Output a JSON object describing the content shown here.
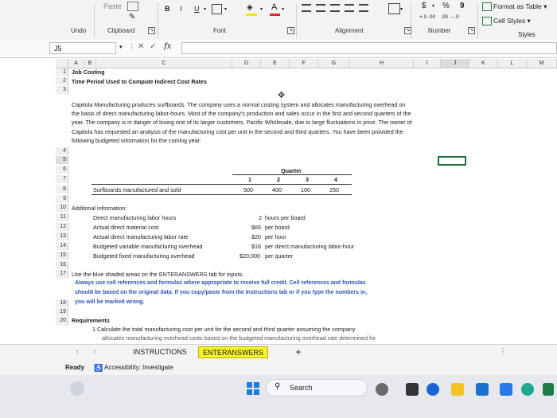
{
  "ribbon": {
    "paste": "Paste",
    "bold": "B",
    "italic": "I",
    "underline": "U",
    "currency": "$",
    "percent": "%",
    "comma": "9",
    "dec_increase": "+.0 .00",
    "dec_decrease": ".00 →.0",
    "format_as_table": "Format as Table",
    "cell_styles": "Cell Styles",
    "styles": "Styles",
    "groups": {
      "undo": "Undo",
      "clipboard": "Clipboard",
      "font": "Font",
      "alignment": "Alignment",
      "number": "Number"
    }
  },
  "formula_bar": {
    "name_box": "J5",
    "fx": "fx",
    "value": ""
  },
  "columns": [
    "A",
    "B",
    "C",
    "D",
    "E",
    "F",
    "G",
    "H",
    "I",
    "J",
    "K",
    "L",
    "M"
  ],
  "rows": [
    "1",
    "2",
    "3",
    "4",
    "5",
    "6",
    "7",
    "8",
    "9",
    "10",
    "11",
    "12",
    "13",
    "14",
    "15",
    "16",
    "17",
    "18",
    "19",
    "20"
  ],
  "sheet": {
    "title": "Job Costing",
    "subtitle": "Time Period Used to Compute Indirect Cost Rates",
    "intro": "Capitola Manufacturing produces surfboards. The company uses a normal costing system and allocates manufacturing overhead on the basis of direct manufacturing labor-hours. Most of the company's production and sales occur in the first and second quarters of the year. The company is in danger of losing one of its larger customers, Pacific Wholesale, due to large fluctuations in price. The owner of Capitola has requested an analysis of the manufacturing cost per unit in the second and third quarters. You have been provided the following budgeted information for the coming year:",
    "quarter_header": "Quarter",
    "quarters": [
      "1",
      "2",
      "3",
      "4"
    ],
    "surfboards_label": "Surfboards manufactured and sold",
    "surfboards_values": [
      "500",
      "400",
      "100",
      "250"
    ],
    "additional_info": "Additonal information:",
    "info_rows": [
      {
        "label": "Direct manufacturing labor hours",
        "value": "2",
        "unit": "hours per board"
      },
      {
        "label": "Actual direct material cost",
        "value": "$65",
        "unit": "per board"
      },
      {
        "label": "Actual direct manufacturing labor rate",
        "value": "$20",
        "unit": "per hour"
      },
      {
        "label": "Budgeted variable manufacturing overhead",
        "value": "$16",
        "unit": "per direct manufacturing labor-hour"
      },
      {
        "label": "Budgeted fixed manufacturing overhead",
        "value": "$20,000",
        "unit": "per quarter"
      }
    ],
    "instruction_1": "Use the blue shaded areas on the ENTERANSWERS tab for inputs.",
    "instruction_2a": "Always use cell references and formulas where appropriate to receive full credit. Cell references and formulas",
    "instruction_2b": "should be based on the original data. If you copy/paste from the Instructions tab or if you type the numbers in,",
    "instruction_2c": "you will be marked wrong.",
    "requirements": "Requirements",
    "req_1a": "1  Calculate the total manufacturing cost per unit for the second and third quarter assuming the company",
    "req_1b": "allocates manufacturing overhead costs based on the budgeted manufacturing overhead rate determined for"
  },
  "tabs": {
    "instructions": "INSTRUCTIONS",
    "enteranswers": "ENTERANSWERS",
    "add": "+"
  },
  "status": {
    "ready": "Ready",
    "accessibility": "Accessibility: Investigate"
  },
  "taskbar": {
    "search": "Search"
  }
}
